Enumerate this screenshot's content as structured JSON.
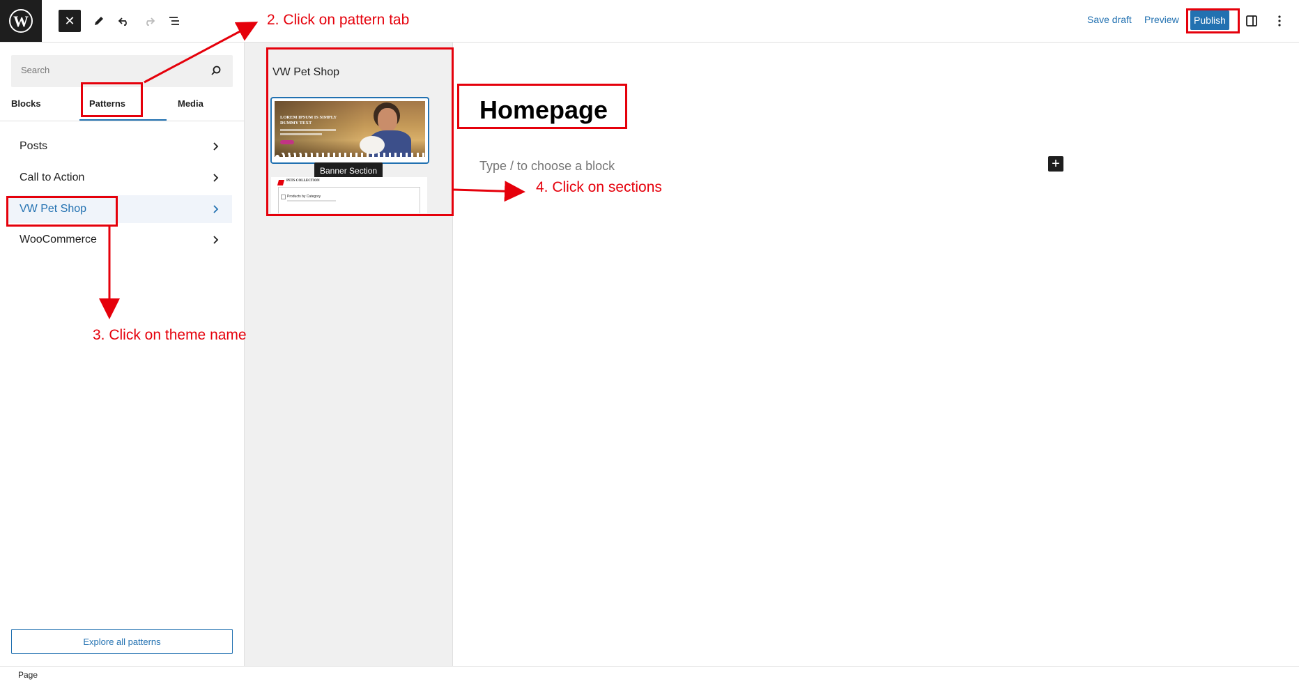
{
  "toolbar": {
    "save_draft": "Save draft",
    "preview": "Preview",
    "publish": "Publish",
    "icons": [
      "wordpress-logo",
      "close",
      "pencil",
      "undo",
      "redo",
      "document-overview",
      "settings-sidebar",
      "more-options"
    ]
  },
  "inserter": {
    "search_placeholder": "Search",
    "tabs": [
      "Blocks",
      "Patterns",
      "Media"
    ],
    "active_tab": "Patterns",
    "categories": [
      {
        "label": "Posts"
      },
      {
        "label": "Call to Action"
      },
      {
        "label": "VW Pet Shop",
        "active": true
      },
      {
        "label": "WooCommerce"
      }
    ],
    "explore_button": "Explore all patterns"
  },
  "patterns_panel": {
    "title": "VW Pet Shop",
    "tooltip": "Banner Section",
    "banner_preview": {
      "heading_line1": "LOREM IPSUM IS SIMPLY",
      "heading_line2": "DUMMY TEXT"
    },
    "products_preview": {
      "heading": "PETS COLLECTION",
      "subheading": "Products by Category"
    }
  },
  "editor": {
    "title": "Homepage",
    "placeholder": "Type / to choose a block"
  },
  "footer": {
    "breadcrumb": "Page"
  },
  "annotations": {
    "step2": "2. Click on pattern tab",
    "step3": "3. Click on theme name",
    "step4": "4. Click on sections"
  },
  "colors": {
    "accent": "#2271b1",
    "annotation": "#e5000b",
    "dark": "#1e1e1e"
  }
}
